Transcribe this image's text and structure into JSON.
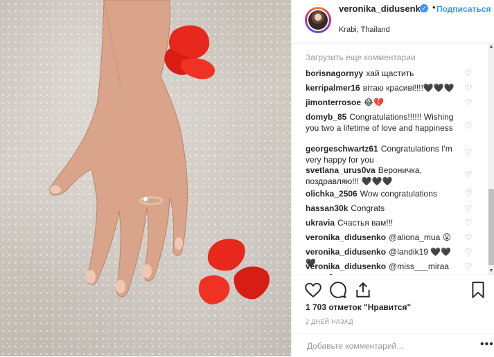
{
  "post": {
    "author": "veronika_didusenko",
    "follow_label": "Подписаться",
    "location": "Krabi, Thailand"
  },
  "comments": {
    "load_more": "Загрузить еще комментарии",
    "items": [
      {
        "user": "borisnagornyy",
        "text": "хай щастить"
      },
      {
        "user": "kerripalmer16",
        "text": "вітаю красиві!!!!🖤🖤🖤"
      },
      {
        "user": "jimonterrosoe",
        "text": "😂💔"
      },
      {
        "user": "domyb_85",
        "text": "Congratulations!!!!!! Wishing you two a lifetime of love and happiness"
      },
      {
        "user": "georgeschwartz61",
        "text": "Congratulations I'm very happy for you"
      },
      {
        "user": "svetlana_urus0va",
        "text": "Вероничка, поздравляю!!! 🖤🖤🖤"
      },
      {
        "user": "olichka_2506",
        "text": "Wow congratulations"
      },
      {
        "user": "hassan30k",
        "text": "Congrats"
      },
      {
        "user": "ukravia",
        "text": "Счастья вам!!!"
      },
      {
        "user": "veronika_didusenko",
        "text": "@aliona_mua 😮"
      },
      {
        "user": "veronika_didusenko",
        "text": "@landik19 🖤🖤🖤"
      },
      {
        "user": "veronika_didusenko",
        "text": "@miss___miraa спасибо"
      }
    ]
  },
  "stats": {
    "likes": "1 703 отметок \"Нравится\"",
    "time": "2 ДНЕЙ НАЗАД"
  },
  "add_comment": {
    "placeholder": "Добавьте комментарий...",
    "more": "•••"
  },
  "icons": {
    "verified": "verified-badge-icon",
    "like": "heart-icon",
    "comment": "comment-bubble-icon",
    "share": "share-icon",
    "save": "bookmark-icon"
  },
  "colors": {
    "link_blue": "#3897f0",
    "text": "#262626",
    "muted": "#999999",
    "petal_red": "#e8271d"
  }
}
